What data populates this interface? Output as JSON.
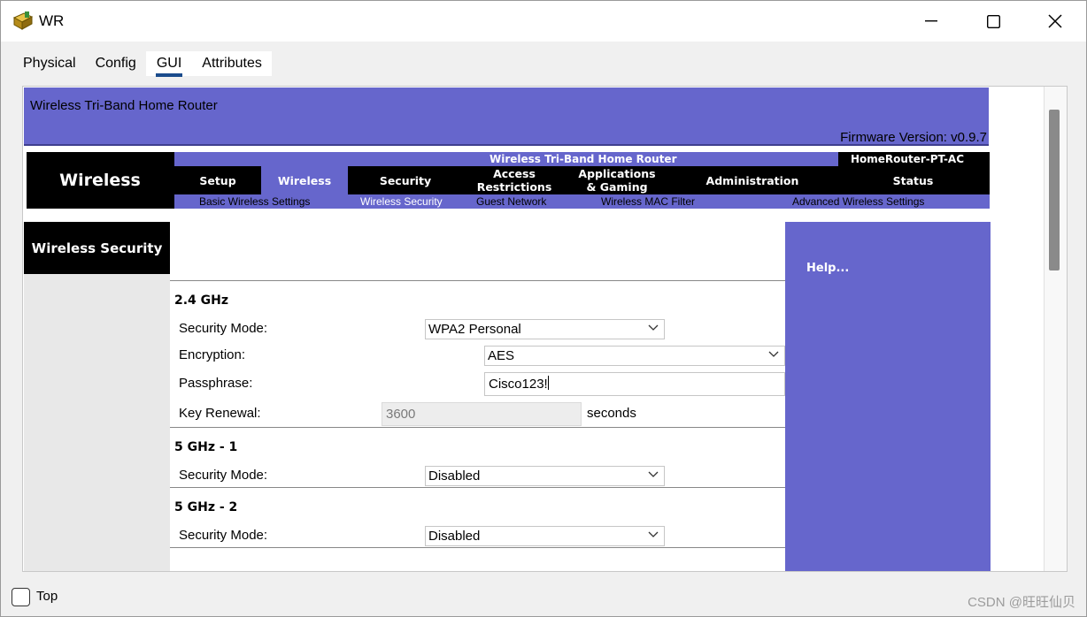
{
  "window": {
    "title": "WR",
    "icons": [
      "app-router-icon",
      "minimize-icon",
      "maximize-icon",
      "close-icon"
    ]
  },
  "tabs": [
    {
      "label": "Physical",
      "active": false
    },
    {
      "label": "Config",
      "active": false
    },
    {
      "label": "GUI",
      "active": true
    },
    {
      "label": "Attributes",
      "active": false
    }
  ],
  "router": {
    "header_title": "Wireless Tri-Band Home Router",
    "firmware": "Firmware Version: v0.9.7",
    "logo": "Wireless",
    "product_name": "Wireless Tri-Band Home Router",
    "model": "HomeRouter-PT-AC",
    "nav": [
      {
        "label": "Setup",
        "active": false
      },
      {
        "label": "Wireless",
        "active": true
      },
      {
        "label": "Security",
        "active": false
      },
      {
        "label": "Access\nRestrictions",
        "active": false
      },
      {
        "label": "Applications\n& Gaming",
        "active": false
      },
      {
        "label": "Administration",
        "active": false
      },
      {
        "label": "Status",
        "active": false
      }
    ],
    "subnav": [
      {
        "label": "Basic Wireless Settings",
        "active": false
      },
      {
        "label": "Wireless Security",
        "active": true
      },
      {
        "label": "Guest Network",
        "active": false
      },
      {
        "label": "Wireless MAC Filter",
        "active": false
      },
      {
        "label": "Advanced Wireless Settings",
        "active": false
      }
    ],
    "section_heading": "Wireless Security",
    "help": "Help...",
    "band_24": {
      "title": "2.4 GHz",
      "security_mode_label": "Security Mode:",
      "security_mode_value": "WPA2 Personal",
      "encryption_label": "Encryption:",
      "encryption_value": "AES",
      "passphrase_label": "Passphrase:",
      "passphrase_value": "Cisco123!",
      "key_renewal_label": "Key Renewal:",
      "key_renewal_value": "3600",
      "key_renewal_unit": "seconds"
    },
    "band_5_1": {
      "title": "5 GHz - 1",
      "security_mode_label": "Security Mode:",
      "security_mode_value": "Disabled"
    },
    "band_5_2": {
      "title": "5 GHz - 2",
      "security_mode_label": "Security Mode:",
      "security_mode_value": "Disabled"
    }
  },
  "footer": {
    "top_label": "Top",
    "top_checked": false,
    "watermark": "CSDN @旺旺仙贝"
  },
  "colors": {
    "router_purple": "#6666cc",
    "router_black": "#000000",
    "tab_underline": "#1a4b8c"
  }
}
